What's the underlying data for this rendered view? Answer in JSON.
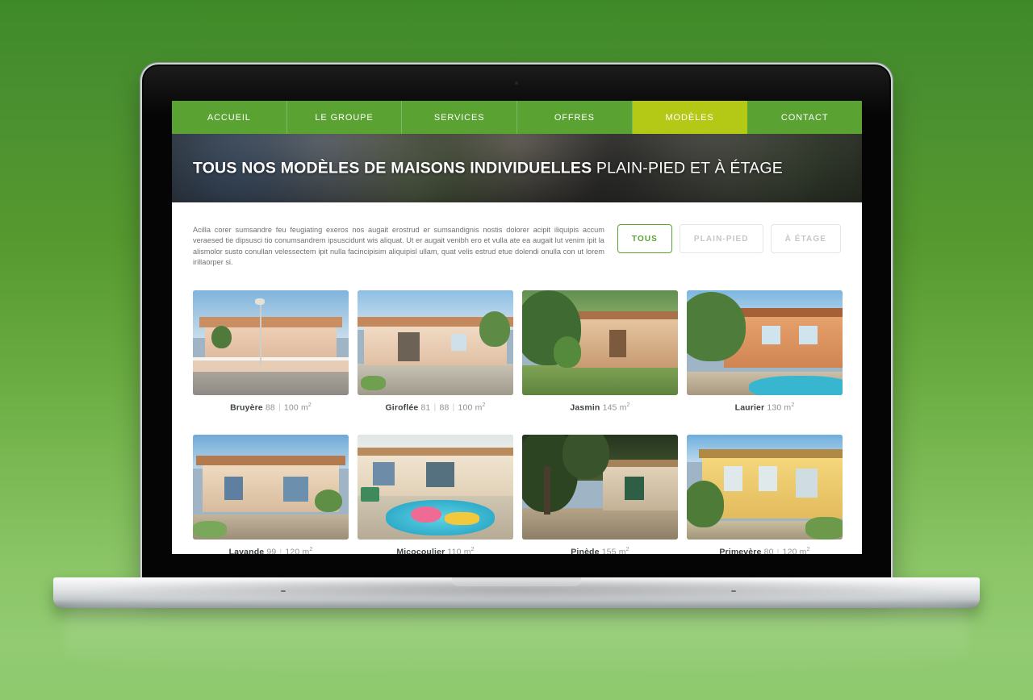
{
  "site": {
    "nav": {
      "items": [
        {
          "label": "ACCUEIL",
          "active": false
        },
        {
          "label": "LE GROUPE",
          "active": false
        },
        {
          "label": "SERVICES",
          "active": false
        },
        {
          "label": "OFFRES",
          "active": false
        },
        {
          "label": "MODÈLES",
          "active": true
        },
        {
          "label": "CONTACT",
          "active": false
        }
      ],
      "colors": {
        "bar": "#5aa332",
        "active": "#b3c915",
        "text": "#ffffff"
      }
    },
    "hero": {
      "title_strong": "TOUS NOS MODÈLES DE MAISONS INDIVIDUELLES",
      "title_light": " PLAIN-PIED ET À ÉTAGE"
    },
    "intro": {
      "paragraph": "Acilla corer sumsandre feu feugiating exeros nos augait erostrud er sumsandignis nostis dolorer acipit iliquipis accum veraesed tie dipsusci tio conumsandrem ipsuscidunt wis aliquat. Ut er augait venibh ero et vulla ate ea augait lut venim ipit la alismolor susto conullan velessectem ipit nulla facincipisim aliquipisl ullam, quat velis estrud etue dolendi onulla con ut lorem irillaorper si."
    },
    "filters": {
      "items": [
        {
          "label": "TOUS",
          "active": true
        },
        {
          "label": "PLAIN-PIED",
          "active": false
        },
        {
          "label": "À ÉTAGE",
          "active": false
        }
      ],
      "active_color": "#5aa332",
      "inactive_color": "#c3c7c9"
    },
    "models": [
      {
        "name": "Bruyère",
        "values": [
          "88",
          "100"
        ],
        "unit": "m"
      },
      {
        "name": "Giroflée",
        "values": [
          "81",
          "88",
          "100"
        ],
        "unit": "m"
      },
      {
        "name": "Jasmin",
        "values": [
          "145"
        ],
        "unit": "m"
      },
      {
        "name": "Laurier",
        "values": [
          "130"
        ],
        "unit": "m"
      },
      {
        "name": "Lavande",
        "values": [
          "99",
          "120"
        ],
        "unit": "m"
      },
      {
        "name": "Micocoulier",
        "values": [
          "110"
        ],
        "unit": "m"
      },
      {
        "name": "Pinède",
        "values": [
          "155"
        ],
        "unit": "m"
      },
      {
        "name": "Primevère",
        "values": [
          "80",
          "120"
        ],
        "unit": "m"
      }
    ],
    "unit_exponent": "2",
    "value_separator": "|"
  },
  "background": {
    "gradient_top": "#3f8a28",
    "gradient_bottom": "#8ec96e"
  }
}
